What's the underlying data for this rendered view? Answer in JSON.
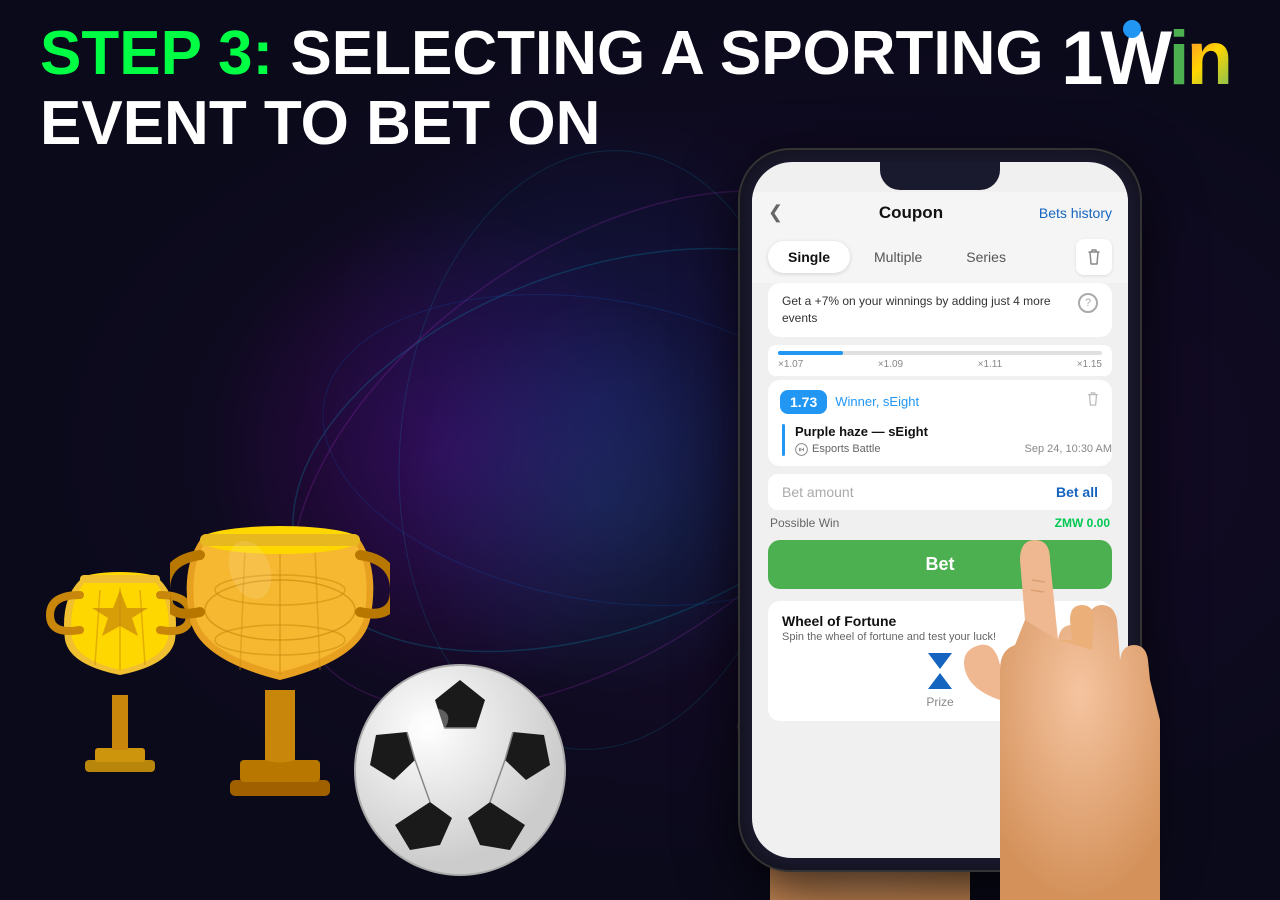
{
  "background": {
    "color": "#0a0a1a"
  },
  "header": {
    "step_label": "STEP 3:",
    "step_text": "SELECTING A SPORTING",
    "step_text2": "EVENT TO BET ON"
  },
  "logo": {
    "text": "1Win",
    "part1": "1",
    "part2": "W",
    "part3": "i",
    "part4": "n"
  },
  "phone": {
    "app": {
      "header": {
        "chevron": "❮",
        "title": "Coupon",
        "bets_history": "Bets history"
      },
      "tabs": [
        {
          "label": "Single",
          "active": true
        },
        {
          "label": "Multiple",
          "active": false
        },
        {
          "label": "Series",
          "active": false
        }
      ],
      "trash_icon": "🗑",
      "promo": {
        "text": "Get a +7% on your winnings by adding just 4 more events"
      },
      "progress": {
        "labels": [
          "×1.07",
          "×1.09",
          "×1.11",
          "×1.15"
        ]
      },
      "bet_item": {
        "odds": "1.73",
        "type": "Winner, sEight",
        "match": "Purple haze — sEight",
        "league": "Esports Battle",
        "date": "Sep 24, 10:30 AM"
      },
      "bet_amount": {
        "placeholder": "Bet amount",
        "bet_all": "Bet all"
      },
      "possible_win": {
        "label": "Possible Win",
        "value": "ZMW 0.00"
      },
      "bet_button": "Bet",
      "wheel": {
        "title": "Wheel of Fortune",
        "subtitle": "Spin the wheel of fortune and test your luck!",
        "prize_label": "Prize"
      }
    }
  }
}
